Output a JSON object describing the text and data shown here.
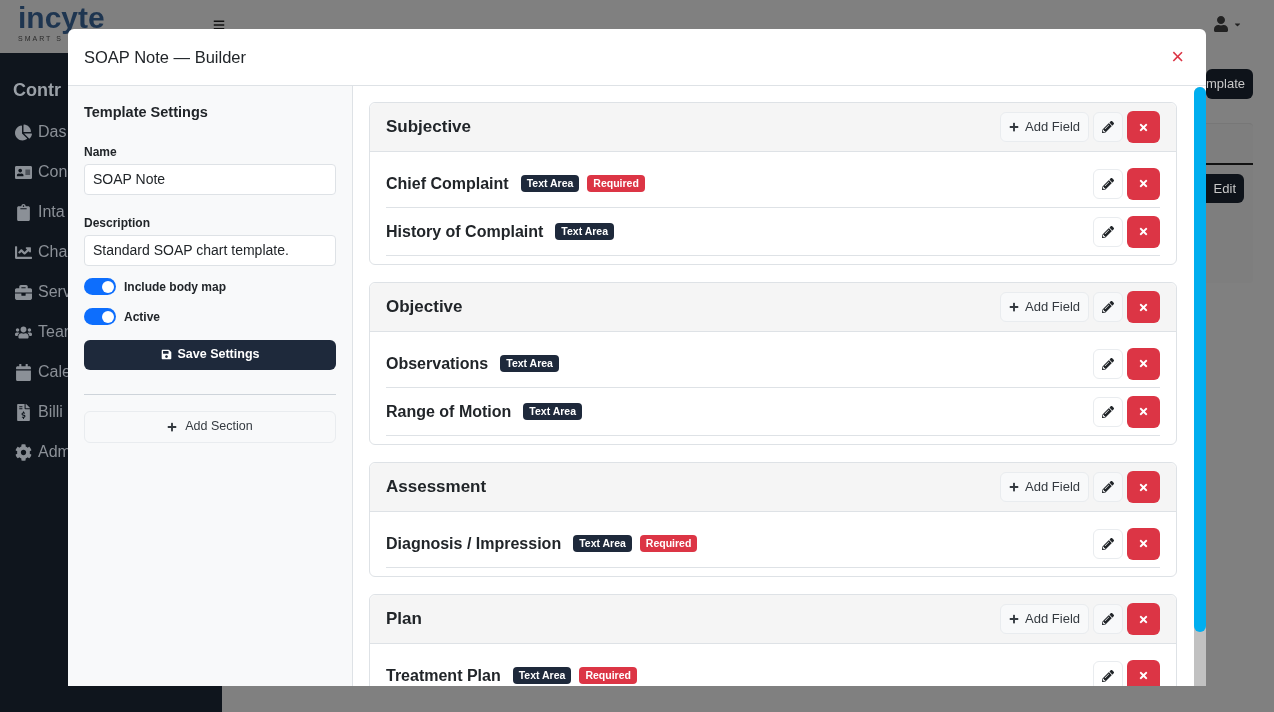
{
  "app": {
    "logo": "incyte",
    "logo_tagline": "SMART S",
    "sidebar_title": "Contr",
    "sidebar_items": [
      "Das",
      "Con",
      "Inta",
      "Cha",
      "Serv",
      "Tear",
      "Cale",
      "Billi",
      "Adm"
    ],
    "header_button": "mplate",
    "card_button": "Edit"
  },
  "modal": {
    "title": "SOAP Note — Builder",
    "close": "×",
    "settings": {
      "heading": "Template Settings",
      "name_label": "Name",
      "name_value": "SOAP Note",
      "description_label": "Description",
      "description_value": "Standard SOAP chart template.",
      "toggles": [
        {
          "label": "Include body map",
          "on": true
        },
        {
          "label": "Active",
          "on": true
        }
      ],
      "save_button": "Save Settings",
      "add_section_button": "Add Section"
    },
    "sections": [
      {
        "title": "Subjective",
        "add_field": "Add Field",
        "fields": [
          {
            "label": "Chief Complaint",
            "type": "Text Area",
            "required": true,
            "required_label": "Required"
          },
          {
            "label": "History of Complaint",
            "type": "Text Area",
            "required": false
          }
        ]
      },
      {
        "title": "Objective",
        "add_field": "Add Field",
        "fields": [
          {
            "label": "Observations",
            "type": "Text Area",
            "required": false
          },
          {
            "label": "Range of Motion",
            "type": "Text Area",
            "required": false
          }
        ]
      },
      {
        "title": "Assessment",
        "add_field": "Add Field",
        "fields": [
          {
            "label": "Diagnosis / Impression",
            "type": "Text Area",
            "required": true,
            "required_label": "Required"
          }
        ]
      },
      {
        "title": "Plan",
        "add_field": "Add Field",
        "fields": [
          {
            "label": "Treatment Plan",
            "type": "Text Area",
            "required": true,
            "required_label": "Required"
          }
        ]
      }
    ]
  }
}
